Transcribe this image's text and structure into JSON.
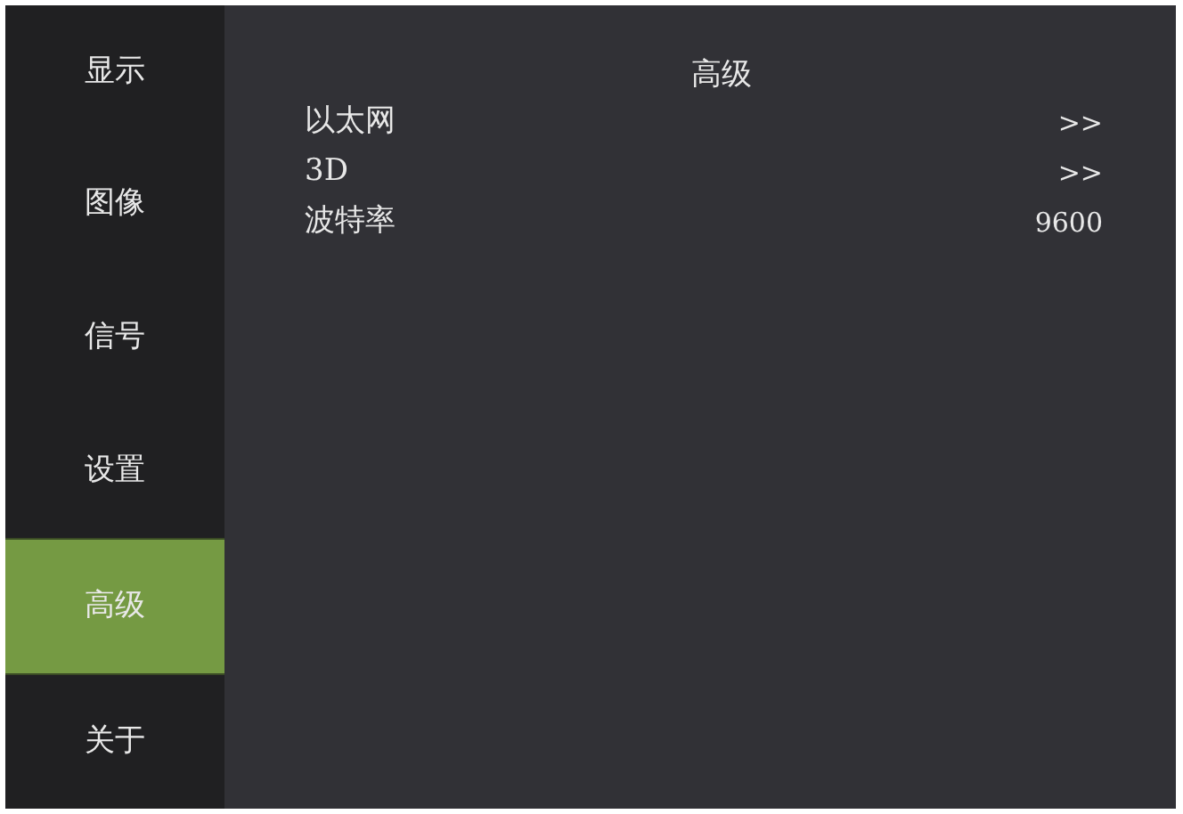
{
  "sidebar": {
    "items": [
      {
        "label": "显示",
        "selected": false
      },
      {
        "label": "图像",
        "selected": false
      },
      {
        "label": "信号",
        "selected": false
      },
      {
        "label": "设置",
        "selected": false
      },
      {
        "label": "高级",
        "selected": true
      },
      {
        "label": "关于",
        "selected": false
      }
    ]
  },
  "panel": {
    "title": "高级",
    "rows": [
      {
        "label": "以太网",
        "value": ">>"
      },
      {
        "label": "3D",
        "value": ">>"
      },
      {
        "label": "波特率",
        "value": "9600"
      }
    ]
  }
}
